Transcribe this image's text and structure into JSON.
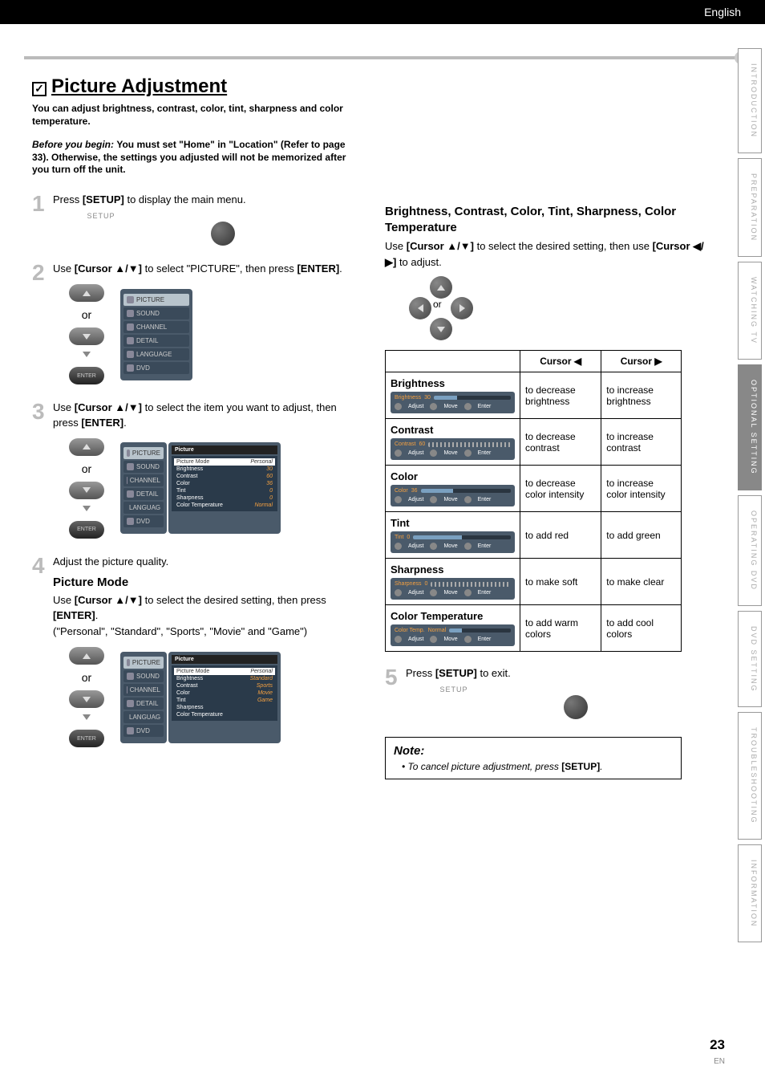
{
  "header": {
    "lang": "English"
  },
  "title": "Picture Adjustment",
  "intro": "You can adjust brightness, contrast, color, tint, sharpness and color temperature.",
  "before": {
    "label": "Before you begin:",
    "text": "You must set \"Home\" in \"Location\" (Refer to page 33). Otherwise, the settings you adjusted will not be memorized after you turn off the unit."
  },
  "steps": {
    "s1": {
      "num": "1",
      "pre": "Press ",
      "bold": "[SETUP]",
      "post": " to display the main menu.",
      "btn_label": "SETUP"
    },
    "s2": {
      "num": "2",
      "pre": "Use ",
      "bold": "[Cursor ▲/▼]",
      "mid": " to select \"PICTURE\", then press ",
      "bold2": "[ENTER]",
      "post": "."
    },
    "s3": {
      "num": "3",
      "pre": "Use ",
      "bold": "[Cursor ▲/▼]",
      "mid": " to select the item you want to adjust, then press ",
      "bold2": "[ENTER]",
      "post": "."
    },
    "s4": {
      "num": "4",
      "text": "Adjust the picture quality."
    },
    "s5": {
      "num": "5",
      "pre": "Press ",
      "bold": "[SETUP]",
      "post": " to exit.",
      "btn_label": "SETUP"
    }
  },
  "or": "or",
  "enter": "ENTER",
  "menu_items": [
    "PICTURE",
    "SOUND",
    "CHANNEL",
    "DETAIL",
    "LANGUAGE",
    "DVD"
  ],
  "picture_mode": {
    "heading": "Picture Mode",
    "line_pre": "Use ",
    "line_bold": "[Cursor ▲/▼]",
    "line_mid": " to select the desired setting, then press ",
    "line_bold2": "[ENTER]",
    "line_post": ".",
    "options_line": "(\"Personal\", \"Standard\", \"Sports\", \"Movie\" and \"Game\")"
  },
  "settings_panel": {
    "title": "Picture",
    "rows": [
      {
        "k": "Picture Mode",
        "v": "Personal",
        "sel": true
      },
      {
        "k": "Brightness",
        "v": "30"
      },
      {
        "k": "Contrast",
        "v": "60"
      },
      {
        "k": "Color",
        "v": "36"
      },
      {
        "k": "Tint",
        "v": "0"
      },
      {
        "k": "Sharpness",
        "v": "0"
      },
      {
        "k": "Color Temperature",
        "v": "Normal"
      }
    ]
  },
  "settings_panel2": {
    "title": "Picture",
    "rows": [
      {
        "k": "Picture Mode",
        "v": "Personal",
        "sel": true
      },
      {
        "k": "Brightness",
        "v": "Standard"
      },
      {
        "k": "Contrast",
        "v": "Sports"
      },
      {
        "k": "Color",
        "v": "Movie"
      },
      {
        "k": "Tint",
        "v": "Game"
      },
      {
        "k": "Sharpness",
        "v": ""
      },
      {
        "k": "Color Temperature",
        "v": ""
      }
    ]
  },
  "right": {
    "heading": "Brightness, Contrast, Color, Tint, Sharpness, Color Temperature",
    "line_pre": "Use ",
    "line_b1": "[Cursor ▲/▼]",
    "line_mid": " to select the desired setting, then use ",
    "line_b2": "[Cursor ◀/▶]",
    "line_post": " to adjust."
  },
  "table": {
    "h_empty": "",
    "h_left": "Cursor ◀",
    "h_right": "Cursor ▶",
    "rows": [
      {
        "name": "Brightness",
        "osd_name": "Brightness",
        "osd_val": "30",
        "fill": 30,
        "left": "to decrease brightness",
        "right": "to increase brightness",
        "bar": "normal"
      },
      {
        "name": "Contrast",
        "osd_name": "Contrast",
        "osd_val": "60",
        "fill": 60,
        "left": "to decrease contrast",
        "right": "to increase contrast",
        "bar": "tick"
      },
      {
        "name": "Color",
        "osd_name": "Color",
        "osd_val": "36",
        "fill": 36,
        "left": "to decrease color intensity",
        "right": "to increase color intensity",
        "bar": "normal"
      },
      {
        "name": "Tint",
        "osd_name": "Tint",
        "osd_val": "0",
        "fill": 50,
        "left": "to add red",
        "right": "to add green",
        "bar": "normal"
      },
      {
        "name": "Sharpness",
        "osd_name": "Sharpness",
        "osd_val": "0",
        "fill": 0,
        "left": "to make soft",
        "right": "to make clear",
        "bar": "tick"
      },
      {
        "name": "Color Temperature",
        "osd_name": "Color Temp.",
        "osd_val": "Normal",
        "fill": 20,
        "left": "to add warm colors",
        "right": "to add cool colors",
        "bar": "normal"
      }
    ],
    "osd_footer": [
      "Adjust",
      "Move",
      "Enter"
    ]
  },
  "note": {
    "title": "Note:",
    "item_pre": "To cancel picture adjustment, press ",
    "item_bold": "[SETUP]",
    "item_post": "."
  },
  "tabs": [
    "INTRODUCTION",
    "PREPARATION",
    "WATCHING TV",
    "OPTIONAL SETTING",
    "OPERATING DVD",
    "DVD SETTING",
    "TROUBLESHOOTING",
    "INFORMATION"
  ],
  "active_tab": 3,
  "page_number": "23",
  "page_lang": "EN"
}
